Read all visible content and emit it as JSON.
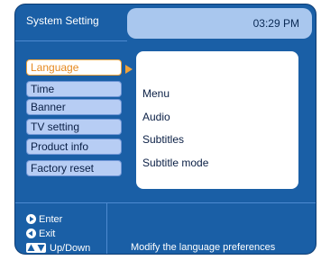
{
  "header": {
    "title": "System Setting",
    "time": "03:29 PM"
  },
  "menu": {
    "items": [
      {
        "label": "Language",
        "selected": true
      },
      {
        "label": "Time",
        "selected": false
      },
      {
        "label": "Banner",
        "selected": false
      },
      {
        "label": "TV setting",
        "selected": false
      },
      {
        "label": "Product info",
        "selected": false
      },
      {
        "label": "Factory reset",
        "selected": false
      }
    ]
  },
  "submenu": {
    "items": [
      "Menu",
      "Audio",
      "Subtitles",
      "Subtitle mode"
    ]
  },
  "legend": {
    "enter": "Enter",
    "exit": "Exit",
    "updown": "Up/Down"
  },
  "help_text": "Modify the language preferences",
  "colors": {
    "frame": "#1a5fa6",
    "highlight": "#f0a23a",
    "menu_item": "#b7cdf4",
    "header_box": "#a9c7ee"
  },
  "icons": {
    "enter": "right-triangle-icon",
    "exit": "left-triangle-icon",
    "updown": "up-down-arrows-icon",
    "pointer": "selection-arrow-icon"
  }
}
